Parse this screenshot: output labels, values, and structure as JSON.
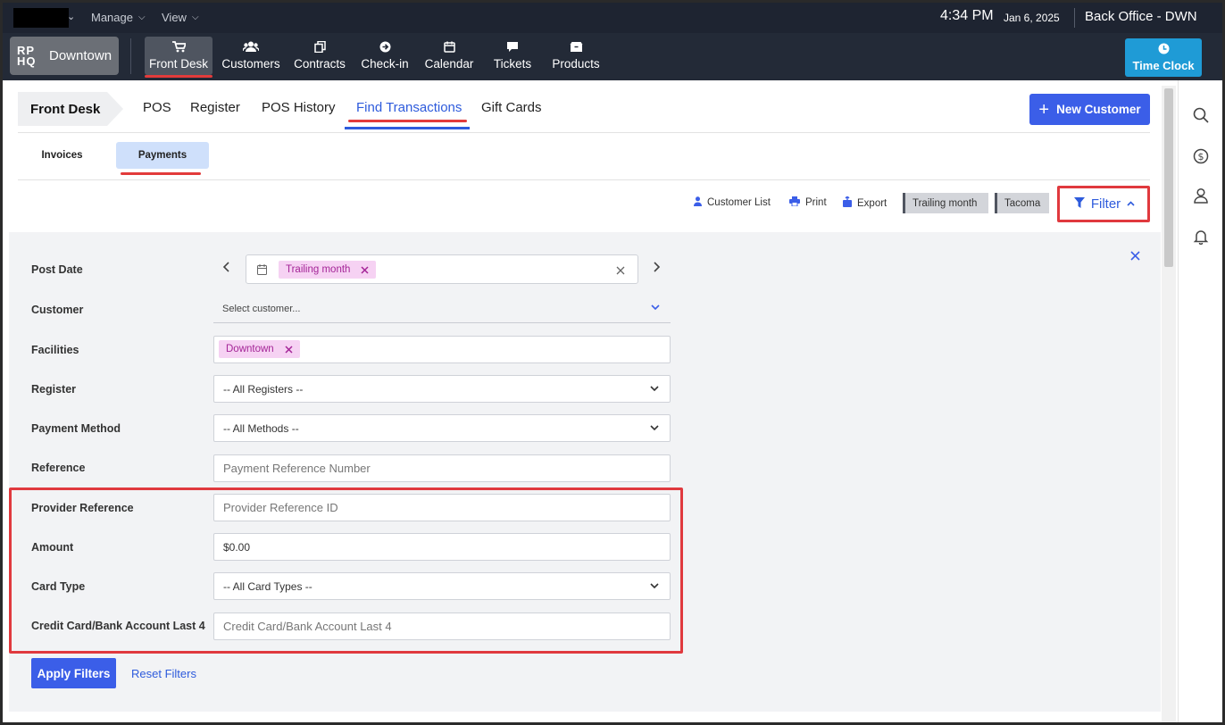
{
  "system_bar": {
    "menus": [
      "Manage",
      "View"
    ],
    "time": "4:34 PM",
    "date": "Jan 6, 2025",
    "office": "Back Office - DWN"
  },
  "nav": {
    "brand_logo": "RP HQ",
    "brand_name": "Downtown",
    "items": [
      {
        "label": "Front Desk",
        "icon": "cart-icon"
      },
      {
        "label": "Customers",
        "icon": "users-icon"
      },
      {
        "label": "Contracts",
        "icon": "contracts-icon"
      },
      {
        "label": "Check-in",
        "icon": "check-in-icon"
      },
      {
        "label": "Calendar",
        "icon": "calendar-icon"
      },
      {
        "label": "Tickets",
        "icon": "chat-icon"
      },
      {
        "label": "Products",
        "icon": "box-icon"
      }
    ],
    "time_clock": "Time Clock"
  },
  "tabs": {
    "breadcrumb": "Front Desk",
    "items": [
      "POS",
      "Register",
      "POS History",
      "Find Transactions",
      "Gift Cards"
    ],
    "active": "Find Transactions",
    "new_customer": "New Customer"
  },
  "subtabs": {
    "items": [
      "Invoices",
      "Payments"
    ],
    "active": "Payments"
  },
  "toolbar": {
    "customer_list": "Customer List",
    "print": "Print",
    "export": "Export",
    "chip_period": "Trailing month",
    "chip_location": "Tacoma",
    "filter": "Filter"
  },
  "filters": {
    "post_date": {
      "label": "Post Date",
      "value": "Trailing month"
    },
    "customer": {
      "label": "Customer",
      "placeholder": "Select customer..."
    },
    "facilities": {
      "label": "Facilities",
      "value": "Downtown"
    },
    "register": {
      "label": "Register",
      "value": "-- All Registers --"
    },
    "payment_method": {
      "label": "Payment Method",
      "value": "-- All Methods --"
    },
    "reference": {
      "label": "Reference",
      "placeholder": "Payment Reference Number"
    },
    "provider_reference": {
      "label": "Provider Reference",
      "placeholder": "Provider Reference ID"
    },
    "amount": {
      "label": "Amount",
      "value": "$0.00"
    },
    "card_type": {
      "label": "Card Type",
      "value": "-- All Card Types --"
    },
    "last4": {
      "label": "Credit Card/Bank Account Last 4",
      "placeholder": "Credit Card/Bank Account Last 4"
    }
  },
  "actions": {
    "apply": "Apply Filters",
    "reset": "Reset Filters"
  },
  "colors": {
    "accent": "#3b5ee8",
    "highlight": "#e0393e",
    "time_clock": "#1f9bd6",
    "pill_bg": "#f6d2f3",
    "pill_text": "#a42597"
  }
}
